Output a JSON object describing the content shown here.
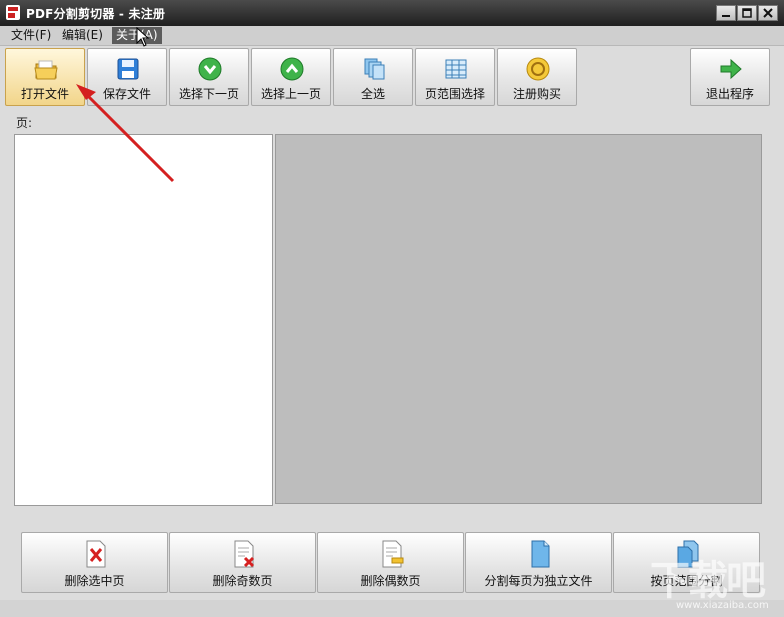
{
  "window": {
    "title": "PDF分割剪切器 - 未注册",
    "controls": [
      "minimize",
      "maximize",
      "close"
    ]
  },
  "menu": {
    "items": [
      {
        "label": "文件(F)"
      },
      {
        "label": "编辑(E)"
      },
      {
        "label": "关于(A)"
      }
    ]
  },
  "toolbar": {
    "buttons": [
      {
        "label": "打开文件",
        "icon": "folder-icon"
      },
      {
        "label": "保存文件",
        "icon": "save-icon"
      },
      {
        "label": "选择下一页",
        "icon": "select-next-page-icon"
      },
      {
        "label": "选择上一页",
        "icon": "select-prev-page-icon"
      },
      {
        "label": "全选",
        "icon": "select-all-icon"
      },
      {
        "label": "页范围选择",
        "icon": "page-range-icon"
      },
      {
        "label": "注册购买",
        "icon": "register-buy-icon"
      }
    ],
    "exit_label": "退出程序"
  },
  "page_label": "页:",
  "bottom_actions": [
    {
      "label": "删除选中页",
      "icon": "delete-selected-page-icon"
    },
    {
      "label": "删除奇数页",
      "icon": "delete-odd-pages-icon"
    },
    {
      "label": "删除偶数页",
      "icon": "delete-even-pages-icon"
    },
    {
      "label": "分割每页为独立文件",
      "icon": "split-each-page-icon"
    },
    {
      "label": "按页范围分割",
      "icon": "split-by-range-icon"
    }
  ],
  "watermark": {
    "text": "下载吧",
    "url": "www.xiazaiba.com"
  },
  "colors": {
    "titlebar": "#2b2b2b",
    "preview_bg": "#bdbdbd",
    "arrow": "#d42020"
  }
}
